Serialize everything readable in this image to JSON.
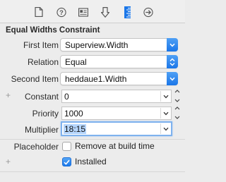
{
  "toolbar": {
    "tabs": [
      {
        "icon": "file-inspector-icon"
      },
      {
        "icon": "quick-help-icon"
      },
      {
        "icon": "identity-inspector-icon"
      },
      {
        "icon": "attributes-inspector-icon"
      },
      {
        "icon": "size-inspector-icon",
        "selected": true
      },
      {
        "icon": "connections-inspector-icon"
      }
    ],
    "accent_color": "#1a76e8"
  },
  "constraint": {
    "section_title": "Equal Widths Constraint",
    "first_item_label": "First Item",
    "first_item_value": "Superview.Width",
    "relation_label": "Relation",
    "relation_value": "Equal",
    "second_item_label": "Second Item",
    "second_item_value": "heddaue1.Width",
    "constant_label": "Constant",
    "constant_value": "0",
    "priority_label": "Priority",
    "priority_value": "1000",
    "multiplier_label": "Multiplier",
    "multiplier_value": "18:15",
    "placeholder_label": "Placeholder",
    "remove_at_build_label": "Remove at build time",
    "remove_at_build_checked": false,
    "installed_label": "Installed",
    "installed_checked": true
  }
}
